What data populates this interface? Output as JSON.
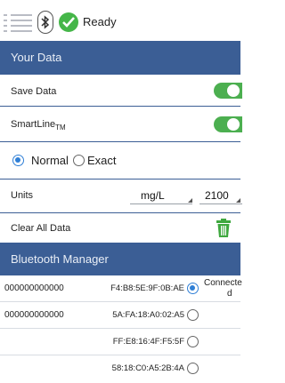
{
  "statusbar": {
    "status_text": "Ready",
    "menu_icon": "menu-list-icon",
    "bluetooth_icon": "bluetooth-icon",
    "ready_icon": "check-circle-icon"
  },
  "your_data": {
    "header": "Your Data",
    "save_data_label": "Save Data",
    "save_data_on": true,
    "smartline_label": "SmartLine",
    "smartline_sub": "TM",
    "smartline_on": true,
    "mode_normal": "Normal",
    "mode_exact": "Exact",
    "mode_selected": "Normal",
    "units_label": "Units",
    "units_value": "mg/L",
    "second_value": "2100",
    "clear_label": "Clear All Data"
  },
  "bluetooth": {
    "header": "Bluetooth Manager",
    "devices": [
      {
        "name": "000000000000",
        "mac": "F4:B8:5E:9F:0B:AE",
        "selected": true,
        "status": "Connecte",
        "status2": "d"
      },
      {
        "name": "000000000000",
        "mac": "5A:FA:18:A0:02:A5",
        "selected": false,
        "status": "",
        "status2": ""
      },
      {
        "name": "",
        "mac": "FF:E8:16:4F:F5:5F",
        "selected": false,
        "status": "",
        "status2": ""
      },
      {
        "name": "",
        "mac": "58:18:C0:A5:2B:4A",
        "selected": false,
        "status": "",
        "status2": ""
      }
    ]
  },
  "colors": {
    "header_bg": "#3b5e95",
    "toggle_on": "#4caf50",
    "radio_on": "#2f7fd6",
    "ready": "#45b649"
  }
}
